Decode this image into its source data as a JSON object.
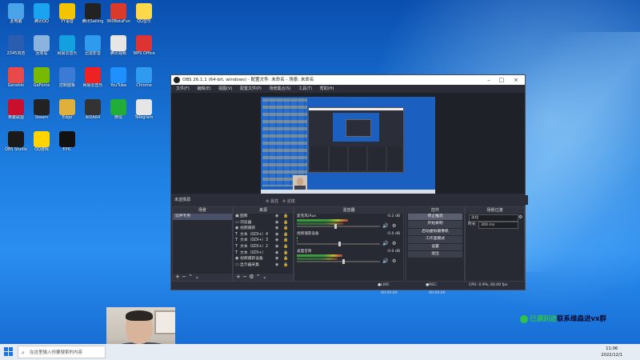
{
  "desktop": {
    "icons": [
      {
        "label": "此电脑",
        "color": "#4aa3e8"
      },
      {
        "label": "腾讯QQ",
        "color": "#1aa3f0"
      },
      {
        "label": "YY语音",
        "color": "#f5c400"
      },
      {
        "label": "腾讯Sailing",
        "color": "#222222"
      },
      {
        "label": "360BetaFun",
        "color": "#d93a2a"
      },
      {
        "label": "QQ音乐",
        "color": "#ffd94a"
      },
      {
        "label": "2345浏览",
        "color": "#2a5db0"
      },
      {
        "label": "回收站",
        "color": "#8ab4e0"
      },
      {
        "label": "网易云音乐",
        "color": "#12a0e0"
      },
      {
        "label": "迅雷影音",
        "color": "#2f9bef"
      },
      {
        "label": "腾讯视频",
        "color": "#e6e6e6"
      },
      {
        "label": "WPS Office",
        "color": "#d33"
      },
      {
        "label": "Genshin",
        "color": "#e84a4a"
      },
      {
        "label": "GeForce",
        "color": "#76b900"
      },
      {
        "label": "控制面板",
        "color": "#3a7bd5"
      },
      {
        "label": "网易云音乐",
        "color": "#e22"
      },
      {
        "label": "YouTube",
        "color": "#1e90ff"
      },
      {
        "label": "Chrome",
        "color": "#2f9bef"
      },
      {
        "label": "英雄联盟",
        "color": "#c8102e"
      },
      {
        "label": "Steam",
        "color": "#222"
      },
      {
        "label": "Edge",
        "color": "#e0b03c"
      },
      {
        "label": "AIDA64",
        "color": "#333"
      },
      {
        "label": "微信",
        "color": "#22ac38"
      },
      {
        "label": "Telegram",
        "color": "#e6e6e6"
      },
      {
        "label": "OBS Studio",
        "color": "#1a1a1a"
      },
      {
        "label": "QQ游戏",
        "color": "#ffd400"
      },
      {
        "label": "EPIC",
        "color": "#111"
      }
    ]
  },
  "obs": {
    "title": "OBS 26.1.1 (64-bit, windows) - 配置文件: 未命名 - 场景: 未命名",
    "menu": [
      "文件(F)",
      "编辑(E)",
      "视图(V)",
      "配置文件(P)",
      "场景集合(S)",
      "工具(T)",
      "帮助(H)"
    ],
    "status_tab": "未选择源",
    "radio": [
      "属性",
      "滤镜"
    ],
    "docks": {
      "scenes": {
        "title": "场景",
        "items": [
          "延伸专用"
        ]
      },
      "sources": {
        "title": "来源",
        "items": [
          {
            "icon": "▣",
            "label": "图像"
          },
          {
            "icon": "▭",
            "label": "浏览器"
          },
          {
            "icon": "◉",
            "label": "视频捕获"
          },
          {
            "icon": "T",
            "label": "文本（GDI+）4"
          },
          {
            "icon": "T",
            "label": "文本（GDI+）3"
          },
          {
            "icon": "T",
            "label": "文本（GDI+）2"
          },
          {
            "icon": "T",
            "label": "文本（GDI+）"
          },
          {
            "icon": "◉",
            "label": "视频捕获设备"
          },
          {
            "icon": "▭",
            "label": "显示器采集"
          }
        ]
      },
      "mixer": {
        "title": "混音器",
        "channels": [
          {
            "name": "麦克风/Aux",
            "db": "-0.2 dB",
            "level": 0.62,
            "fader": 0.45
          },
          {
            "name": "视频捕获设备",
            "db": "-0.0 dB",
            "level": 0.0,
            "fader": 0.5
          },
          {
            "name": "桌面音频",
            "db": "-0.0 dB",
            "level": 0.55,
            "fader": 0.55
          }
        ]
      },
      "transitions": {
        "title": "场景过渡",
        "type_label": "淡化",
        "duration_label": "时长",
        "duration": "300 ms"
      },
      "controls": {
        "title": "控件",
        "buttons": [
          "停止推流",
          "开始录制",
          "启动虚拟摄像机",
          "工作室模式",
          "设置",
          "退出"
        ]
      }
    },
    "statusbar": {
      "live": "LIVE: 00:00:00",
      "rec": "REC: 00:00:00",
      "cpu": "CPU: 0.9%, 60.00 fps"
    }
  },
  "taskbar": {
    "search_placeholder": "在这里输入你要搜索的内容",
    "time": "11:06",
    "date": "2022/12/1"
  },
  "watermark": {
    "green": "已满别进",
    "dark": "联系维森进vx群"
  }
}
